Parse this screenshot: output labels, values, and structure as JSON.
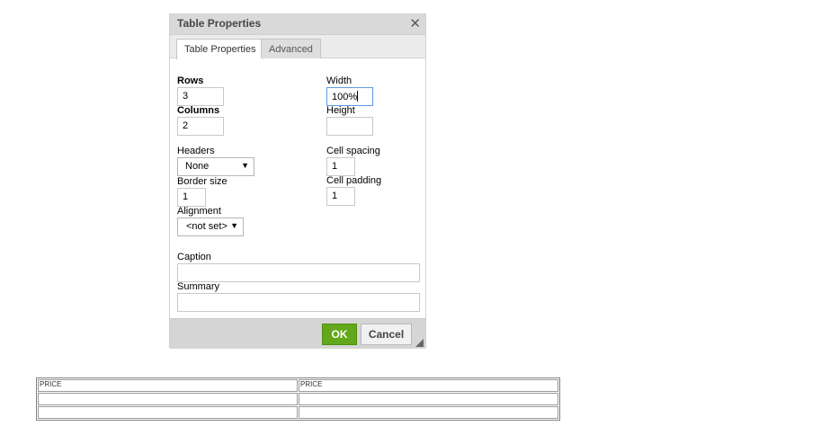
{
  "dialog": {
    "title": "Table Properties",
    "tabs": [
      {
        "label": "Table Properties",
        "active": true
      },
      {
        "label": "Advanced",
        "active": false
      }
    ],
    "fields": {
      "rows": {
        "label": "Rows",
        "value": "3"
      },
      "columns": {
        "label": "Columns",
        "value": "2"
      },
      "width": {
        "label": "Width",
        "value": "100%"
      },
      "height": {
        "label": "Height",
        "value": ""
      },
      "headers": {
        "label": "Headers",
        "value": "None"
      },
      "cell_spacing": {
        "label": "Cell spacing",
        "value": "1"
      },
      "border_size": {
        "label": "Border size",
        "value": "1"
      },
      "cell_padding": {
        "label": "Cell padding",
        "value": "1"
      },
      "alignment": {
        "label": "Alignment",
        "value": "<not set>"
      },
      "caption": {
        "label": "Caption",
        "value": ""
      },
      "summary": {
        "label": "Summary",
        "value": ""
      }
    },
    "buttons": {
      "ok": "OK",
      "cancel": "Cancel"
    },
    "icons": {
      "close": "close-icon",
      "dropdown": "chevron-down-icon",
      "resize": "resize-grip-icon"
    },
    "colors": {
      "ok_button": "#62a81a",
      "focus_border": "#5c9be0"
    }
  },
  "page_table": {
    "rows": [
      [
        "PRICE",
        "PRICE"
      ],
      [
        "",
        ""
      ],
      [
        "",
        ""
      ]
    ]
  }
}
